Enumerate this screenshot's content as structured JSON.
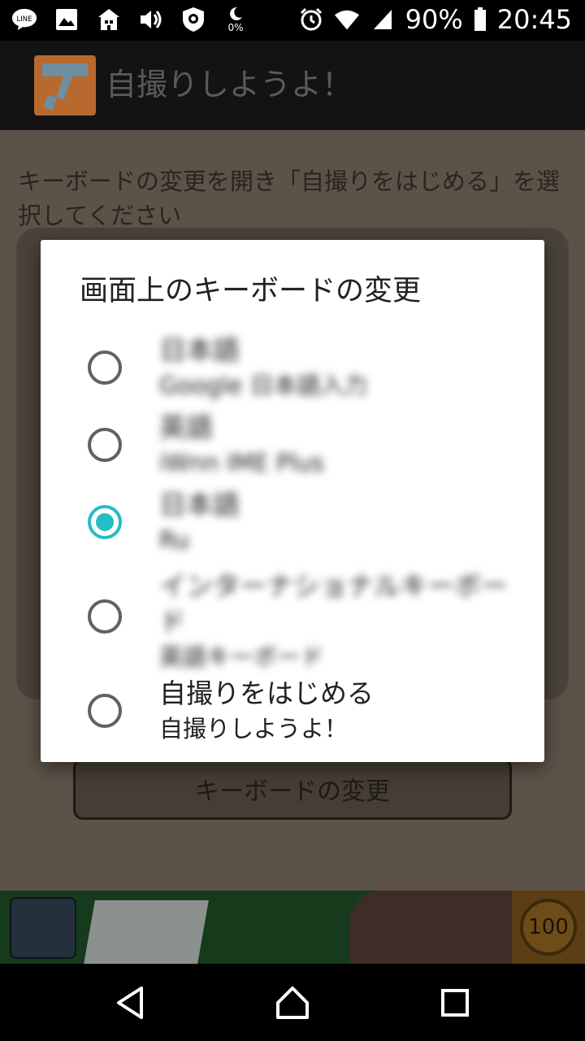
{
  "status_bar": {
    "battery_percent": "90%",
    "time": "20:45",
    "vpn_label": "0%",
    "line_icon_text": "LINE"
  },
  "app_bar": {
    "title": "自撮りしようよ！"
  },
  "main": {
    "instruction": "キーボードの変更を開き「自撮りをはじめる」を選択してください",
    "change_keyboard_button": "キーボードの変更"
  },
  "ad": {
    "badge_text": "100"
  },
  "dialog": {
    "title": "画面上のキーボードの変更",
    "options": [
      {
        "primary": "日本語",
        "secondary": "Google 日本語入力",
        "selected": false
      },
      {
        "primary": "英語",
        "secondary": "iWnn IME Plus",
        "selected": false
      },
      {
        "primary": "日本語",
        "secondary": "Ru",
        "selected": true
      },
      {
        "primary": "インターナショナルキーボード",
        "secondary": "英語キーボード",
        "selected": false
      },
      {
        "primary": "自撮りをはじめる",
        "secondary": "自撮りしようよ！",
        "selected": false
      }
    ]
  },
  "colors": {
    "accent": "#26bcc6",
    "app_logo": "#b8692e"
  }
}
